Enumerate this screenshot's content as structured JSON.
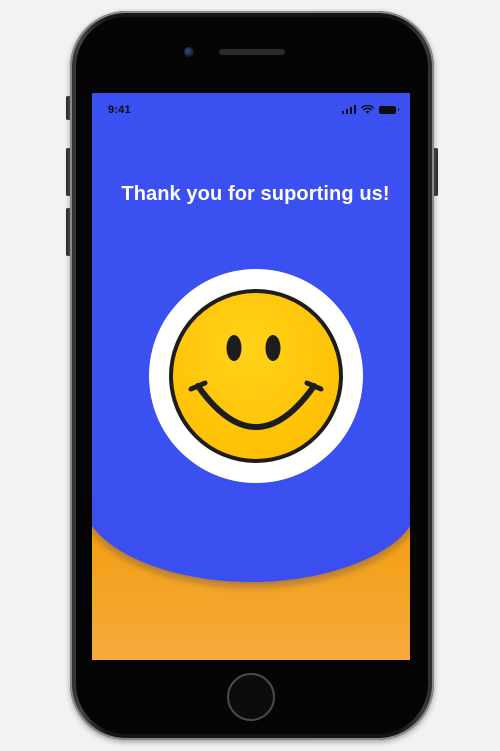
{
  "status_bar": {
    "time": "9:41",
    "signal_icon": "cellular-signal-icon",
    "wifi_icon": "wifi-icon",
    "battery_icon": "battery-icon"
  },
  "main": {
    "headline": "Thank you for suporting us!",
    "illustration_icon": "smiley-face-icon"
  },
  "colors": {
    "screen_background": "#3b50f0",
    "wave_top": "#f2a30f",
    "wave_bottom": "#f6a838",
    "smiley_fill": "#ffc708",
    "badge_background": "#ffffff",
    "text": "#ffffff"
  }
}
